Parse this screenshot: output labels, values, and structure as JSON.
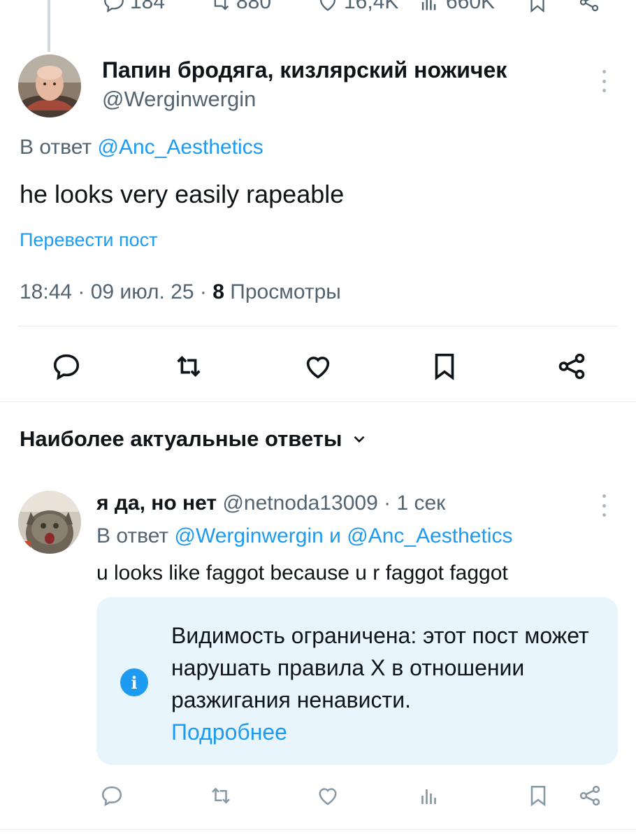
{
  "top_stats": {
    "replies": "184",
    "reposts": "880",
    "likes": "16,4K",
    "views": "660K"
  },
  "tweet": {
    "author_name": "Папин бродяга, кизлярский ножичек",
    "author_handle": "@Werginwergin",
    "reply_prefix": "В ответ",
    "reply_to": "@Anc_Aesthetics",
    "text": "he looks very easily rapeable",
    "translate_label": "Перевести пост",
    "time_date": "18:44 · 09 июл. 25 · ",
    "views_count": "8",
    "views_label": " Просмотры"
  },
  "section": {
    "title": "Наиболее актуальные ответы"
  },
  "reply": {
    "author_name": "я да, но нет",
    "author_handle": " @netnoda13009",
    "time": " · 1 сек",
    "reply_prefix": "В ответ ",
    "reply_to_1": "@Werginwergin",
    "reply_and": " и ",
    "reply_to_2": "@Anc_Aesthetics",
    "text": "u looks like faggot because u r faggot faggot",
    "notice_text": "Видимость ограничена: этот пост может нарушать правила X в отношении разжигания ненависти.",
    "notice_link": "Подробнее"
  },
  "colors": {
    "accent": "#1d9bf0",
    "muted": "#536471",
    "notice_bg": "#e8f5fd"
  }
}
